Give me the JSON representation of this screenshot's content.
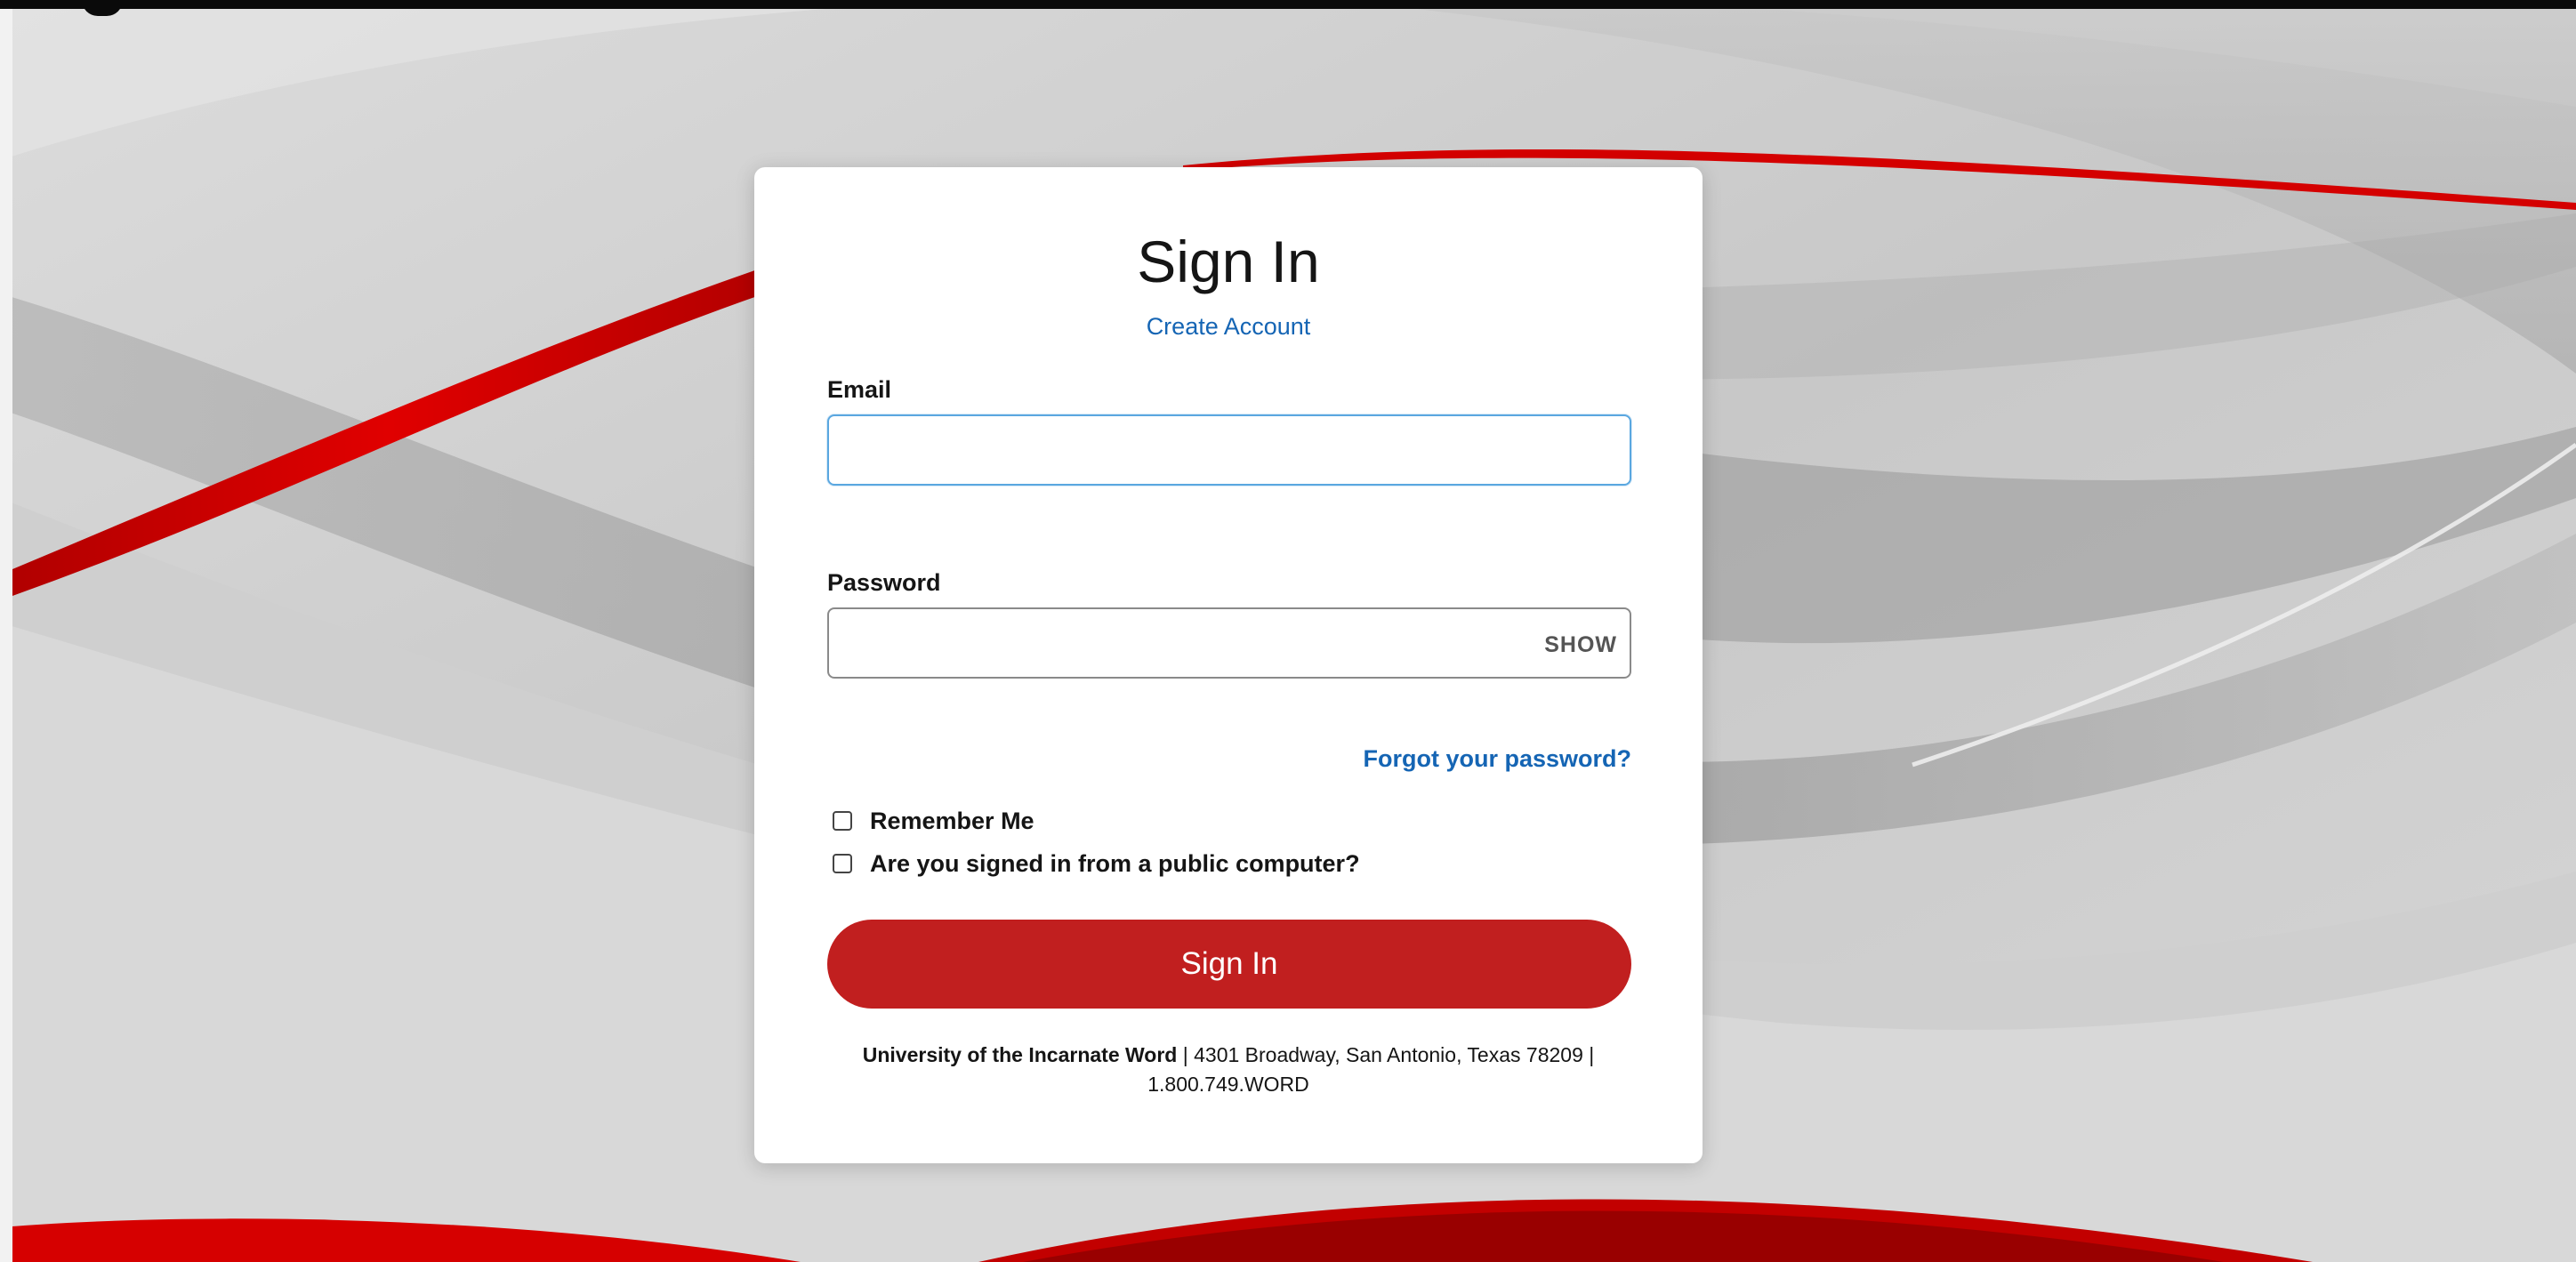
{
  "signin": {
    "title": "Sign In",
    "create_account": "Create Account",
    "email_label": "Email",
    "email_value": "",
    "password_label": "Password",
    "password_value": "",
    "show_toggle": "SHOW",
    "forgot_password": "Forgot your password?",
    "remember_me": "Remember Me",
    "public_computer": "Are you signed in from a public computer?",
    "submit_label": "Sign In"
  },
  "footer": {
    "organization": "University of the Incarnate Word",
    "separator_1": " | ",
    "address": "4301 Broadway, San Antonio, Texas 78209",
    "separator_2": " | ",
    "phone": "1.800.749.WORD"
  },
  "colors": {
    "accent_red": "#c11f1f",
    "link_blue": "#1565b4",
    "focus_blue": "#5aa7e0"
  }
}
